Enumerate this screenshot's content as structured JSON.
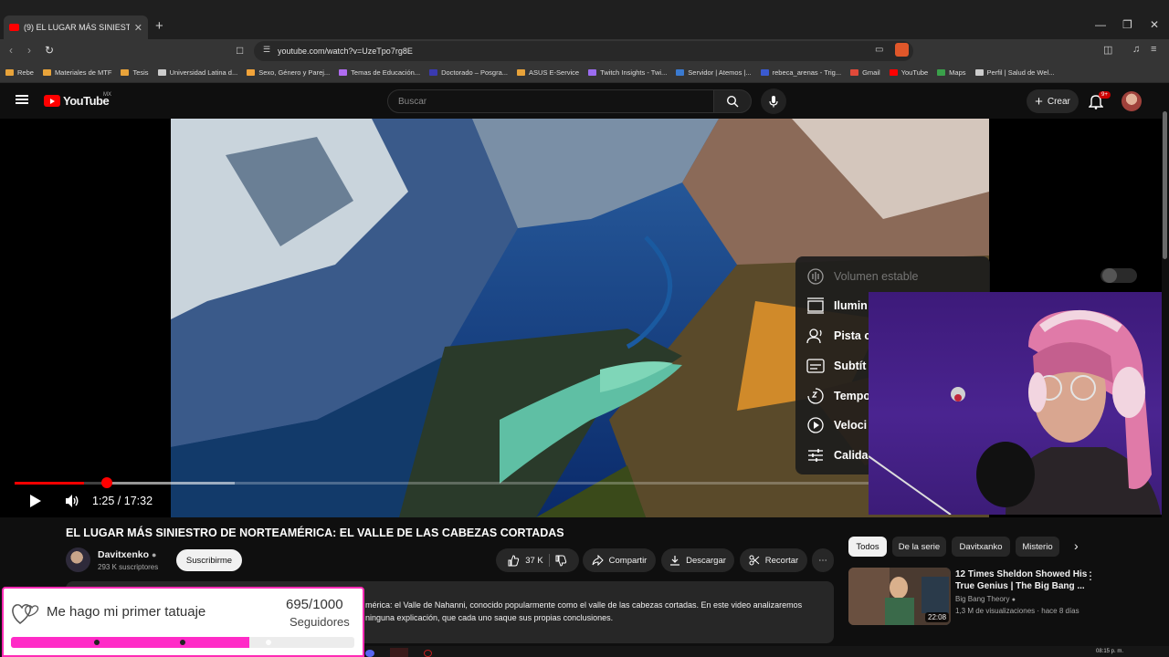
{
  "browser": {
    "tab_title": "(9) EL LUGAR MÁS SINIESTRO DE",
    "tab_close": "✕",
    "new_tab": "+",
    "url": "youtube.com/watch?v=UzeTpo7rg8E",
    "bookmarks": [
      {
        "label": "Rebe",
        "color": "#e8a33a"
      },
      {
        "label": "Materiales de MTF",
        "color": "#e8a33a"
      },
      {
        "label": "Tesis",
        "color": "#e8a33a"
      },
      {
        "label": "Universidad Latina d...",
        "color": "#cccccc"
      },
      {
        "label": "Sexo, Género y Parej...",
        "color": "#f2a43a"
      },
      {
        "label": "Temas de Educación...",
        "color": "#b06cf0"
      },
      {
        "label": "Doctorado – Posgra...",
        "color": "#3a3ab0"
      },
      {
        "label": "ASUS E-Service",
        "color": "#e8a33a"
      },
      {
        "label": "Twitch Insights - Twi...",
        "color": "#9b6cf0"
      },
      {
        "label": "Servidor | Atemos |...",
        "color": "#3a7ad0"
      },
      {
        "label": "rebeca_arenas - Trig...",
        "color": "#3a5ad0"
      },
      {
        "label": "Gmail",
        "color": "#e04a3a"
      },
      {
        "label": "YouTube",
        "color": "#ff0000"
      },
      {
        "label": "Maps",
        "color": "#3aa04a"
      },
      {
        "label": "Perfil | Salud de Wel...",
        "color": "#cccccc"
      }
    ]
  },
  "header": {
    "logo_text": "YouTube",
    "region": "MX",
    "search_placeholder": "Buscar",
    "create_label": "Crear",
    "notif_badge": "9+"
  },
  "player": {
    "time": "1:25 / 17:32",
    "progress": 0.081,
    "settings_menu": [
      {
        "label": "Volumen estable",
        "icon": "stable-volume-icon"
      },
      {
        "label": "Ilumin",
        "icon": "ambient-mode-icon"
      },
      {
        "label": "Pista c",
        "icon": "audio-track-icon"
      },
      {
        "label": "Subtít",
        "icon": "subtitles-icon"
      },
      {
        "label": "Tempo",
        "icon": "sleep-timer-icon"
      },
      {
        "label": "Veloci",
        "icon": "playback-speed-icon"
      },
      {
        "label": "Calida",
        "icon": "quality-icon"
      }
    ]
  },
  "video": {
    "title": "EL LUGAR MÁS SINIESTRO DE NORTEAMÉRICA: EL VALLE DE LAS CABEZAS CORTADAS",
    "channel": "Davitxenko",
    "subscribers": "293 K suscriptores",
    "subscribe_label": "Suscribirme",
    "likes": "37 K",
    "share_label": "Compartir",
    "download_label": "Descargar",
    "clip_label": "Recortar",
    "description_line1": "mérica: el Valle de Nahanni, conocido popularmente como el valle de las cabezas cortadas. En este video analizaremos",
    "description_line2": "ninguna explicación, que cada uno saque sus propias conclusiones."
  },
  "chips": [
    "Todos",
    "De la serie",
    "Davitxanko",
    "Misterio"
  ],
  "recommendation": {
    "title_line1": "12 Times Sheldon Showed His",
    "title_line2": "True Genius | The Big Bang ...",
    "channel": "Big Bang Theory",
    "meta": "1,3 M de visualizaciones · hace 8 días",
    "duration": "22:08"
  },
  "goal_widget": {
    "text": "Me hago mi primer tatuaje",
    "count": "695/1000",
    "label": "Seguidores",
    "progress": 0.695,
    "color": "#ff2bc7"
  },
  "taskbar": {
    "clock": "08:15 p. m."
  }
}
